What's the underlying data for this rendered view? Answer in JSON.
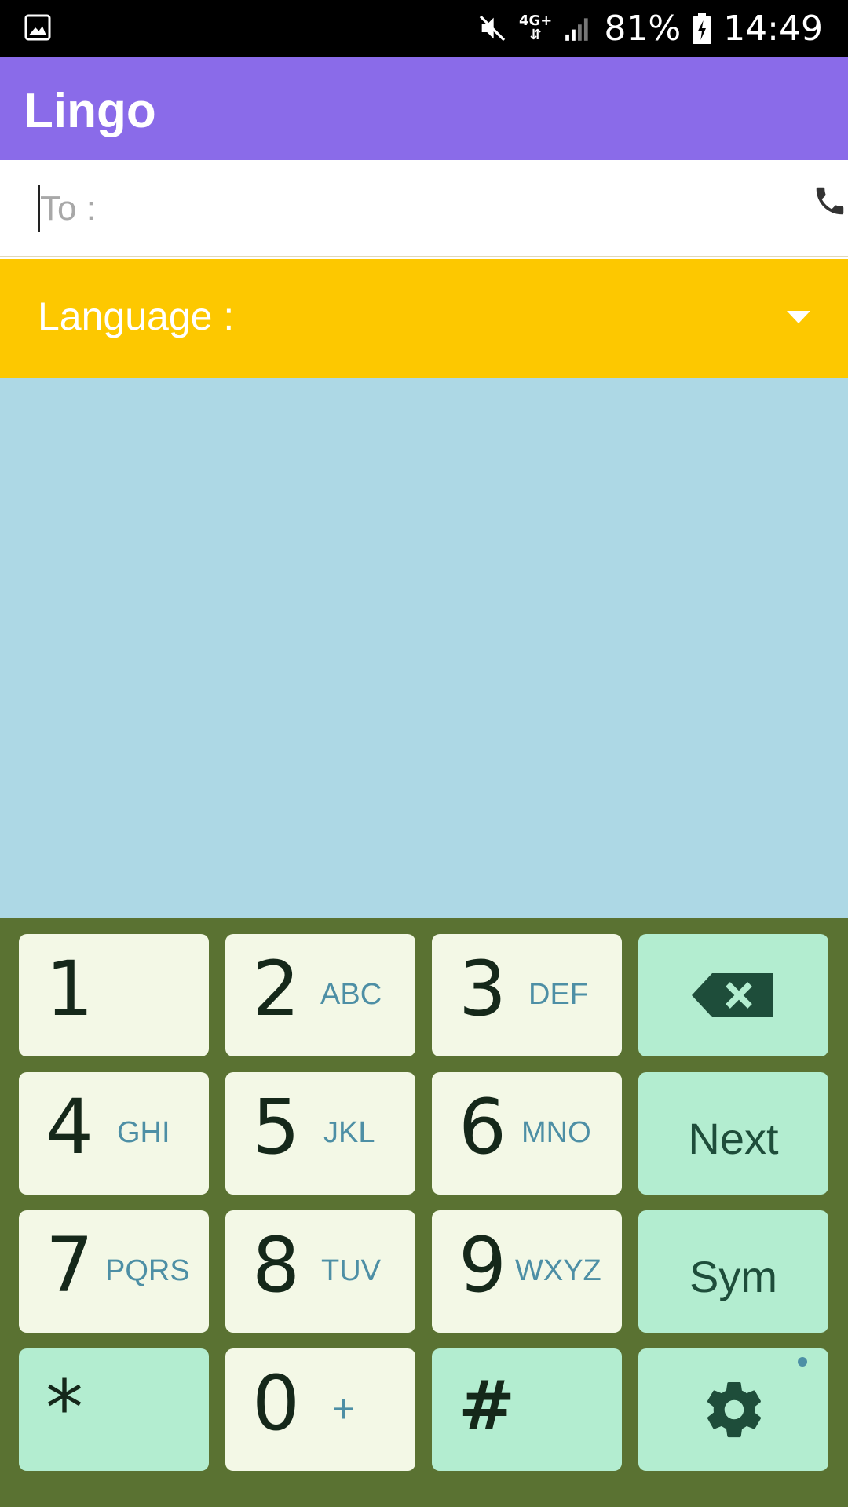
{
  "status_bar": {
    "left_icon": "gallery-icon",
    "network": "4G+",
    "battery": "81%",
    "time": "14:49"
  },
  "app": {
    "title": "Lingo"
  },
  "to_field": {
    "placeholder": "To :",
    "value": "",
    "icon": "phone-icon"
  },
  "language": {
    "label": "Language :",
    "selected": ""
  },
  "keypad": {
    "rows": [
      [
        {
          "digit": "1",
          "letters": ""
        },
        {
          "digit": "2",
          "letters": "ABC"
        },
        {
          "digit": "3",
          "letters": "DEF"
        },
        {
          "icon": "backspace-icon"
        }
      ],
      [
        {
          "digit": "4",
          "letters": "GHI"
        },
        {
          "digit": "5",
          "letters": "JKL"
        },
        {
          "digit": "6",
          "letters": "MNO"
        },
        {
          "label": "Next"
        }
      ],
      [
        {
          "digit": "7",
          "letters": "PQRS"
        },
        {
          "digit": "8",
          "letters": "TUV"
        },
        {
          "digit": "9",
          "letters": "WXYZ"
        },
        {
          "label": "Sym"
        }
      ],
      [
        {
          "digit": "*"
        },
        {
          "digit": "0",
          "letters": "+"
        },
        {
          "digit": "#"
        },
        {
          "icon": "gear-icon"
        }
      ]
    ]
  },
  "colors": {
    "app_bar": "#8a6be9",
    "language_bar": "#fdc800",
    "content_bg": "#add8e5",
    "keypad_bg": "#5a7232",
    "key_light": "#f3f8e6",
    "key_mint": "#b3edd0"
  }
}
